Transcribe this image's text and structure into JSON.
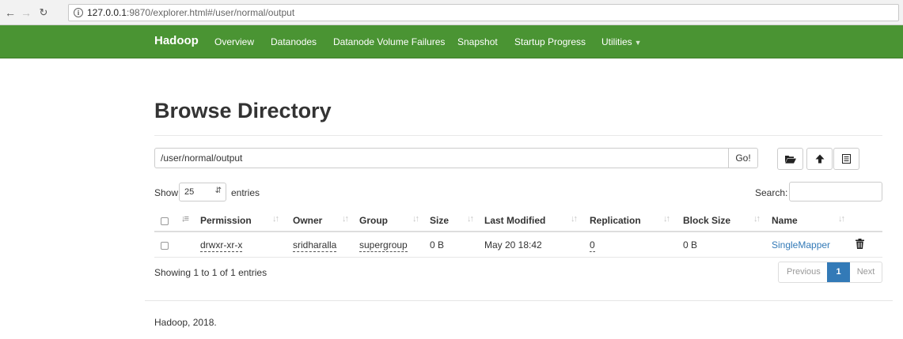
{
  "browser": {
    "url_host": "127.0.0.1",
    "url_path": ":9870/explorer.html#/user/normal/output"
  },
  "navbar": {
    "brand": "Hadoop",
    "items": [
      {
        "label": "Overview"
      },
      {
        "label": "Datanodes"
      },
      {
        "label": "Datanode Volume Failures"
      },
      {
        "label": "Snapshot"
      },
      {
        "label": "Startup Progress"
      },
      {
        "label": "Utilities"
      }
    ]
  },
  "page": {
    "title": "Browse Directory",
    "path_value": "/user/normal/output",
    "go_label": "Go!",
    "icons": [
      "folder-open-icon",
      "upload-icon",
      "list-icon"
    ]
  },
  "table_controls": {
    "show_label": "Show",
    "page_length": "25",
    "entries_label": "entries",
    "search_label": "Search:",
    "search_value": ""
  },
  "table": {
    "columns": [
      "Permission",
      "Owner",
      "Group",
      "Size",
      "Last Modified",
      "Replication",
      "Block Size",
      "Name"
    ],
    "rows": [
      {
        "permission": "drwxr-xr-x",
        "owner": "sridharalla",
        "group": "supergroup",
        "size": "0 B",
        "last_modified": "May 20 18:42",
        "replication": "0",
        "block_size": "0 B",
        "name": "SingleMapper"
      }
    ],
    "info": "Showing 1 to 1 of 1 entries",
    "pagination": {
      "previous": "Previous",
      "current": "1",
      "next": "Next"
    }
  },
  "footer": {
    "text": "Hadoop, 2018."
  },
  "colors": {
    "navbar": "#4a9433",
    "link": "#337ab7",
    "active_page": "#337ab7"
  }
}
